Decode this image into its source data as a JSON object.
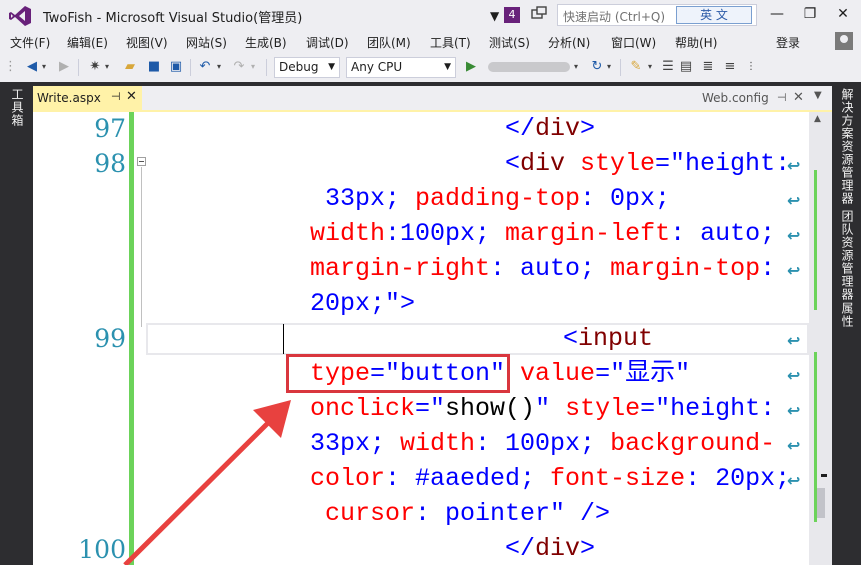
{
  "window": {
    "title": "TwoFish - Microsoft Visual Studio(管理员)",
    "notification_count": "4",
    "quick_launch_placeholder": "快速启动 (Ctrl+Q)",
    "ime_label": "英 文",
    "minimize": "—",
    "restore": "❐",
    "close": "✕"
  },
  "menu": {
    "items": [
      "文件(F)",
      "编辑(E)",
      "视图(V)",
      "网站(S)",
      "生成(B)",
      "调试(D)",
      "团队(M)",
      "工具(T)",
      "测试(S)",
      "分析(N)",
      "窗口(W)",
      "帮助(H)"
    ],
    "sign_in": "登录"
  },
  "toolbar": {
    "configuration": "Debug",
    "platform": "Any CPU"
  },
  "side_panels": {
    "left": "工具箱",
    "right": [
      "解决方案资源管理器",
      "团队资源管理器",
      "属性"
    ]
  },
  "tabs": {
    "active": "Write.aspx",
    "other": "Web.config"
  },
  "editor": {
    "line_numbers": [
      "97",
      "98",
      "99",
      "100"
    ],
    "lines": [
      [
        {
          "t": "</",
          "c": "br"
        },
        {
          "t": "div",
          "c": "tag"
        },
        {
          "t": ">",
          "c": "br"
        }
      ],
      [
        {
          "t": "<",
          "c": "br"
        },
        {
          "t": "div",
          "c": "tag"
        },
        {
          "t": " style",
          "c": "attr"
        },
        {
          "t": "=\"height:",
          "c": "val"
        }
      ],
      [
        {
          "t": "33px; ",
          "c": "val"
        },
        {
          "t": "padding-top",
          "c": "attr"
        },
        {
          "t": ": 0px;",
          "c": "val"
        }
      ],
      [
        {
          "t": "width",
          "c": "attr"
        },
        {
          "t": ":100px; ",
          "c": "val"
        },
        {
          "t": "margin-left",
          "c": "attr"
        },
        {
          "t": ": auto;",
          "c": "val"
        }
      ],
      [
        {
          "t": "margin-right",
          "c": "attr"
        },
        {
          "t": ": auto; ",
          "c": "val"
        },
        {
          "t": "margin-top",
          "c": "attr"
        },
        {
          "t": ":",
          "c": "val"
        }
      ],
      [
        {
          "t": "20px;\"",
          "c": "val"
        },
        {
          "t": ">",
          "c": "br"
        }
      ],
      [
        {
          "t": "<",
          "c": "br"
        },
        {
          "t": "input",
          "c": "tag"
        }
      ],
      [
        {
          "t": "type",
          "c": "attr"
        },
        {
          "t": "=\"button\"",
          "c": "val"
        },
        {
          "t": " value",
          "c": "attr"
        },
        {
          "t": "=\"显示\"",
          "c": "val"
        }
      ],
      [
        {
          "t": "onclick",
          "c": "attr"
        },
        {
          "t": "=\"",
          "c": "val"
        },
        {
          "t": "show()",
          "c": "txt"
        },
        {
          "t": "\"",
          "c": "val"
        },
        {
          "t": " style",
          "c": "attr"
        },
        {
          "t": "=\"height:",
          "c": "val"
        }
      ],
      [
        {
          "t": "33px; ",
          "c": "val"
        },
        {
          "t": "width",
          "c": "attr"
        },
        {
          "t": ": 100px; ",
          "c": "val"
        },
        {
          "t": "background-",
          "c": "attr"
        }
      ],
      [
        {
          "t": "color",
          "c": "attr"
        },
        {
          "t": ": #aaeded; ",
          "c": "val"
        },
        {
          "t": "font-size",
          "c": "attr"
        },
        {
          "t": ": 20px;",
          "c": "val"
        }
      ],
      [
        {
          "t": "cursor",
          "c": "attr"
        },
        {
          "t": ": pointer\" ",
          "c": "val"
        },
        {
          "t": "/>",
          "c": "br"
        }
      ],
      [
        {
          "t": "</",
          "c": "br"
        },
        {
          "t": "div",
          "c": "tag"
        },
        {
          "t": ">",
          "c": "br"
        }
      ]
    ]
  },
  "colors": {
    "tag": "#800000",
    "attribute": "#ff0000",
    "value": "#0000ff",
    "line_number": "#2b91af",
    "change_bar": "#6cd35a",
    "annotation": "#d9363e",
    "active_tab": "#fff2a8"
  }
}
